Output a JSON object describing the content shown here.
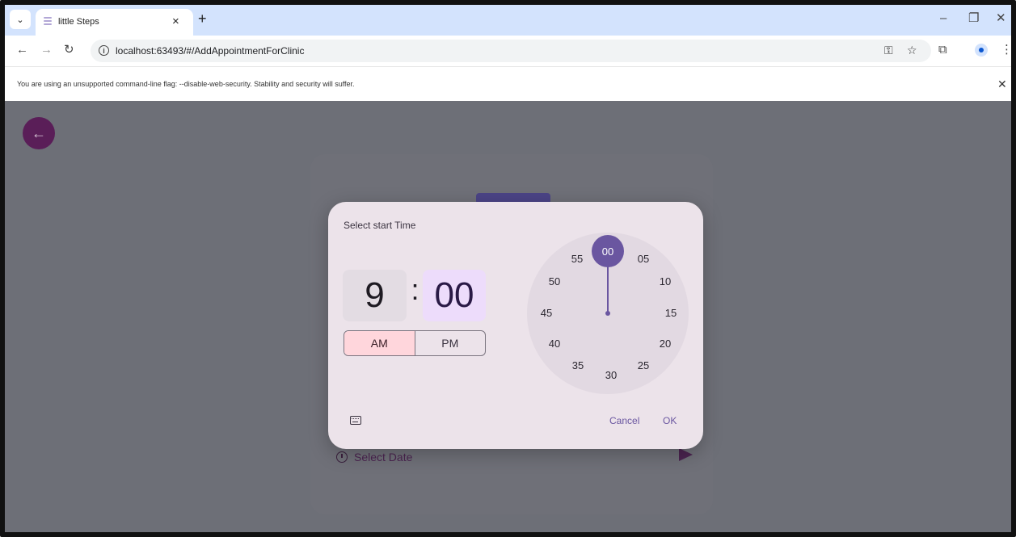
{
  "browser": {
    "tab_title": "little Steps",
    "url": "localhost:63493/#/AddAppointmentForClinic",
    "infobar_text": "You are using an unsupported command-line flag: --disable-web-security. Stability and security will suffer."
  },
  "page": {
    "select_date_label": "Select Date"
  },
  "time_picker": {
    "title": "Select start Time",
    "hour": "9",
    "separator": ":",
    "minute": "00",
    "am_label": "AM",
    "pm_label": "PM",
    "selected_period": "AM",
    "dial_selected": "00",
    "dial_labels": [
      "05",
      "10",
      "15",
      "20",
      "25",
      "30",
      "35",
      "40",
      "45",
      "50",
      "55"
    ],
    "cancel_label": "Cancel",
    "ok_label": "OK"
  },
  "colors": {
    "accent": "#6a56a0",
    "back_button": "#5a1e58",
    "am_selected": "#ffd6dc",
    "minute_box": "#eddcfb",
    "scrim": "#6d6f77"
  },
  "icons": [
    "tab-search-icon",
    "favicon-icon",
    "close-icon",
    "new-tab-icon",
    "minimize-icon",
    "restore-icon",
    "back-arrow-icon",
    "forward-arrow-icon",
    "reload-icon",
    "info-icon",
    "password-key-icon",
    "star-icon",
    "extensions-icon",
    "profile-icon",
    "more-menu-icon",
    "clock-icon",
    "send-icon",
    "keyboard-icon"
  ]
}
